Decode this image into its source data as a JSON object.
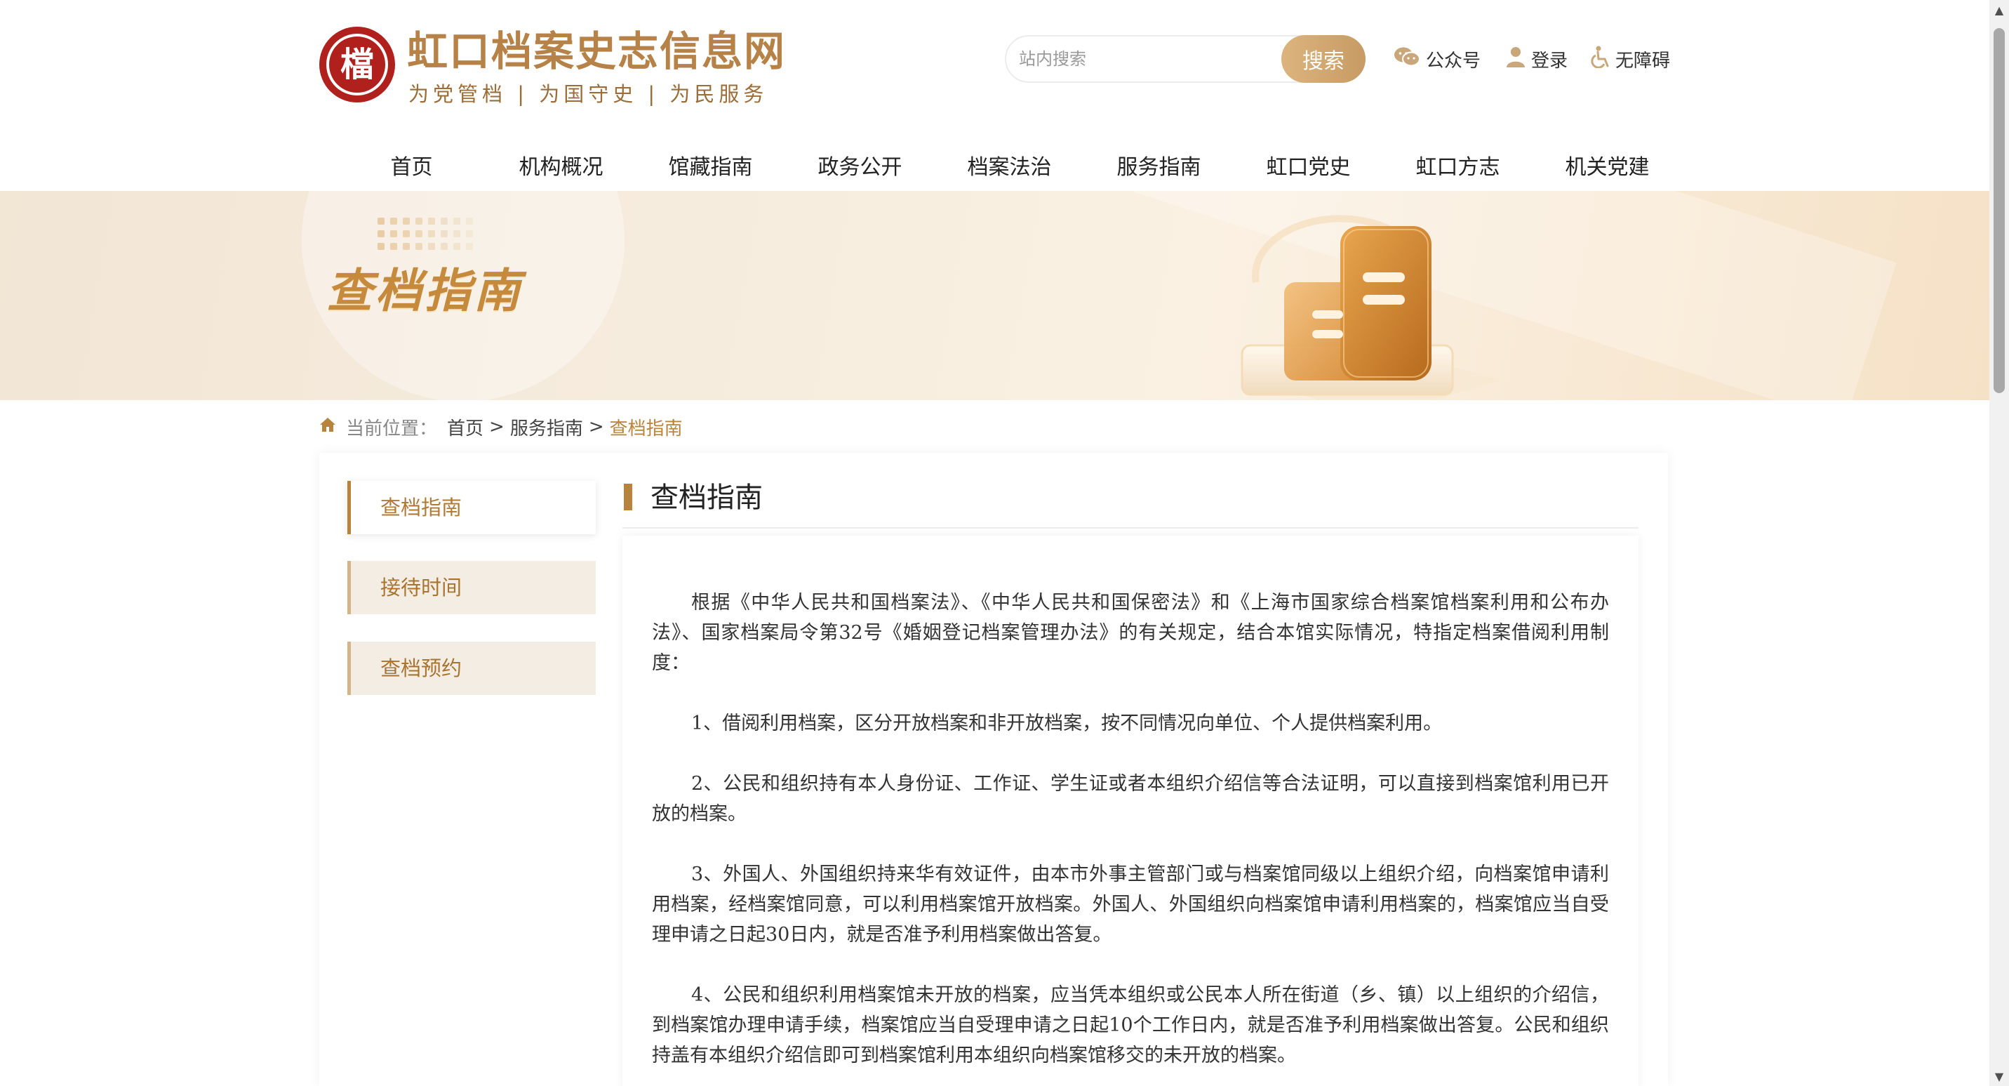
{
  "site": {
    "title": "虹口档案史志信息网",
    "slogan": "为党管档 | 为国守史 | 为民服务",
    "seal_char": "檔"
  },
  "search": {
    "placeholder": "站内搜索",
    "button_label": "搜索"
  },
  "top_links": {
    "wechat": "公众号",
    "login": "登录",
    "accessibility": "无障碍"
  },
  "nav": {
    "items": [
      {
        "label": "首页"
      },
      {
        "label": "机构概况"
      },
      {
        "label": "馆藏指南"
      },
      {
        "label": "政务公开"
      },
      {
        "label": "档案法治"
      },
      {
        "label": "服务指南"
      },
      {
        "label": "虹口党史"
      },
      {
        "label": "虹口方志"
      },
      {
        "label": "机关党建"
      }
    ]
  },
  "banner": {
    "title": "查档指南"
  },
  "breadcrumb": {
    "label": "当前位置：",
    "items": [
      "首页",
      "服务指南"
    ],
    "current": "查档指南",
    "separator": ">"
  },
  "sidebar": {
    "items": [
      {
        "label": "查档指南",
        "active": true
      },
      {
        "label": "接待时间",
        "active": false
      },
      {
        "label": "查档预约",
        "active": false
      }
    ]
  },
  "content": {
    "heading": "查档指南",
    "paragraphs": [
      "根据《中华人民共和国档案法》、《中华人民共和国保密法》和《上海市国家综合档案馆档案利用和公布办法》、国家档案局令第32号《婚姻登记档案管理办法》的有关规定，结合本馆实际情况，特指定档案借阅利用制度：",
      "1、借阅利用档案，区分开放档案和非开放档案，按不同情况向单位、个人提供档案利用。",
      "2、公民和组织持有本人身份证、工作证、学生证或者本组织介绍信等合法证明，可以直接到档案馆利用已开放的档案。",
      "3、外国人、外国组织持来华有效证件，由本市外事主管部门或与档案馆同级以上组织介绍，向档案馆申请利用档案，经档案馆同意，可以利用档案馆开放档案。外国人、外国组织向档案馆申请利用档案的，档案馆应当自受理申请之日起30日内，就是否准予利用档案做出答复。",
      "4、公民和组织利用档案馆未开放的档案，应当凭本组织或公民本人所在街道（乡、镇）以上组织的介绍信，到档案馆办理申请手续，档案馆应当自受理申请之日起10个工作日内，就是否准予利用档案做出答复。公民和组织持盖有本组织介绍信即可到档案馆利用本组织向档案馆移交的未开放的档案。"
    ]
  },
  "colors": {
    "brand_gold": "#b8843d",
    "title_gold": "#b68247",
    "seal_red": "#b0201c",
    "search_button": "#d2a86f",
    "sidebar_inactive_bg": "#f3ede4"
  },
  "icons": [
    "seal-logo-icon",
    "wechat-icon",
    "user-icon",
    "accessibility-icon",
    "home-icon",
    "document-stack-icon",
    "scroll-up-arrow-icon",
    "scroll-down-arrow-icon"
  ]
}
